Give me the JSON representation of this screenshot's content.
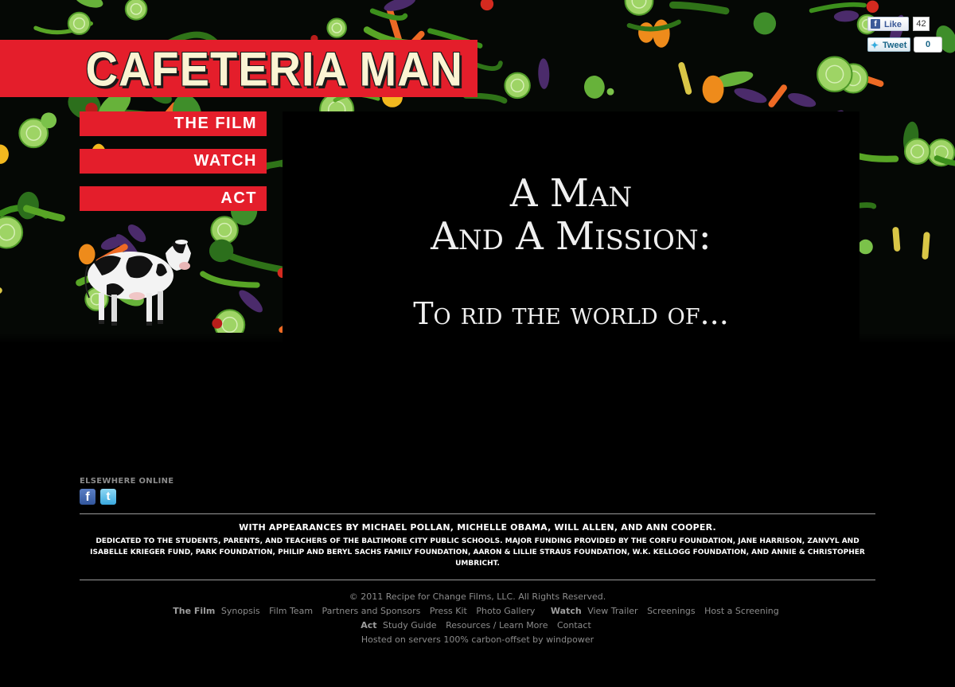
{
  "brand": {
    "logo_text": "CAFETERIA MAN"
  },
  "nav": {
    "items": [
      "THE FILM",
      "WATCH",
      "ACT"
    ]
  },
  "video": {
    "line1": "A Man",
    "line2": "And A Mission:",
    "line3": "To rid the world of..."
  },
  "social_buttons": {
    "like_label": "Like",
    "like_count": "42",
    "tweet_label": "Tweet",
    "tweet_count": "0"
  },
  "elsewhere": {
    "heading": "ELSEWHERE ONLINE",
    "icons": [
      "facebook-icon",
      "twitter-icon"
    ]
  },
  "credits": {
    "appearances": "WITH APPEARANCES BY MICHAEL POLLAN, MICHELLE OBAMA, WILL ALLEN, AND ANN COOPER.",
    "dedication": "DEDICATED TO THE STUDENTS, PARENTS, AND TEACHERS OF THE BALTIMORE CITY PUBLIC SCHOOLS. MAJOR FUNDING PROVIDED BY THE CORFU FOUNDATION, JANE HARRISON, ZANVYL AND ISABELLE KRIEGER FUND, PARK FOUNDATION, PHILIP AND BERYL SACHS FAMILY FOUNDATION, AARON & LILLIE STRAUS FOUNDATION, W.K. KELLOGG FOUNDATION, AND ANNIE & CHRISTOPHER UMBRICHT."
  },
  "footer": {
    "copyright": "© 2011 Recipe for Change Films, LLC. All Rights Reserved.",
    "film_group": "The Film",
    "film_links": [
      "Synopsis",
      "Film Team",
      "Partners and Sponsors",
      "Press Kit",
      "Photo Gallery"
    ],
    "watch_group": "Watch",
    "watch_links": [
      "View Trailer",
      "Screenings",
      "Host a Screening"
    ],
    "act_group": "Act",
    "act_links": [
      "Study Guide",
      "Resources / Learn More",
      "Contact"
    ],
    "hosting": "Hosted on servers 100% carbon-offset by windpower"
  },
  "colors": {
    "brand_red": "#e41e2b",
    "logo_cream": "#fbf4d3",
    "background": "#000000"
  }
}
